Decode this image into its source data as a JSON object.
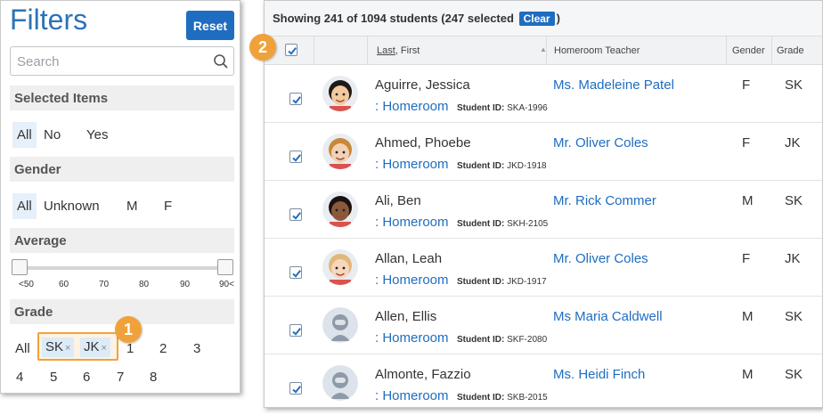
{
  "filters": {
    "title": "Filters",
    "reset_label": "Reset",
    "search_placeholder": "Search",
    "selected_items": {
      "heading": "Selected Items",
      "options": [
        "All",
        "No",
        "Yes"
      ],
      "selected": "All"
    },
    "gender": {
      "heading": "Gender",
      "options": [
        "All",
        "Unknown",
        "M",
        "F"
      ],
      "selected": "All"
    },
    "average": {
      "heading": "Average",
      "ticks": [
        "<50",
        "60",
        "70",
        "80",
        "90",
        "90<"
      ],
      "range_min": "<50",
      "range_max": "90<"
    },
    "grade": {
      "heading": "Grade",
      "all_label": "All",
      "chips": [
        "SK",
        "JK"
      ],
      "chip_remove_glyph": "×",
      "options_row1": [
        "1",
        "2",
        "3"
      ],
      "options_row2": [
        "4",
        "5",
        "6",
        "7",
        "8"
      ]
    }
  },
  "callouts": {
    "one": "1",
    "two": "2"
  },
  "students": {
    "summary_prefix": "Showing 241 of 1094 students  (247 selected",
    "clear_label": "Clear",
    "summary_suffix": ")",
    "columns": {
      "name_underlined": "Last",
      "name_rest": ", First",
      "teacher": "Homeroom Teacher",
      "gender": "Gender",
      "grade": "Grade"
    },
    "homeroom_label": ": Homeroom",
    "student_id_label": "Student ID:",
    "rows": [
      {
        "name": "Aguirre, Jessica",
        "student_id": "SKA-1996",
        "teacher": "Ms. Madeleine Patel",
        "gender": "F",
        "grade": "SK",
        "avatar": "photo"
      },
      {
        "name": "Ahmed, Phoebe",
        "student_id": "JKD-1918",
        "teacher": "Mr. Oliver Coles",
        "gender": "F",
        "grade": "JK",
        "avatar": "photo"
      },
      {
        "name": "Ali, Ben",
        "student_id": "SKH-2105",
        "teacher": "Mr. Rick Commer",
        "gender": "M",
        "grade": "SK",
        "avatar": "photo"
      },
      {
        "name": "Allan, Leah",
        "student_id": "JKD-1917",
        "teacher": "Mr. Oliver Coles",
        "gender": "F",
        "grade": "JK",
        "avatar": "photo"
      },
      {
        "name": "Allen, Ellis",
        "student_id": "SKF-2080",
        "teacher": "Ms Maria Caldwell",
        "gender": "M",
        "grade": "SK",
        "avatar": "placeholder"
      },
      {
        "name": "Almonte, Fazzio",
        "student_id": "SKB-2015",
        "teacher": "Ms. Heidi Finch",
        "gender": "M",
        "grade": "SK",
        "avatar": "placeholder"
      }
    ]
  },
  "colors": {
    "accent": "#1f6dc0",
    "callout": "#f0a23a",
    "selected_bg": "#e6f0fa"
  }
}
